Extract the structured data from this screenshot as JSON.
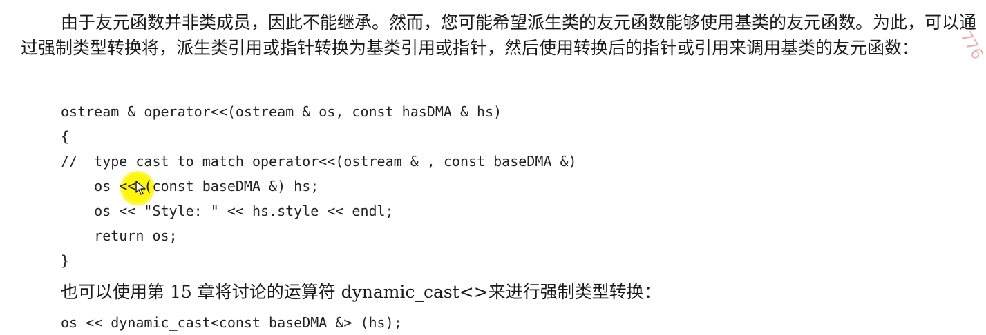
{
  "paragraph1": "由于友元函数并非类成员，因此不能继承。然而，您可能希望派生类的友元函数能够使用基类的友元函数。为此，可以通过强制类型转换将，派生类引用或指针转换为基类引用或指针，然后使用转换后的指针或引用来调用基类的友元函数：",
  "code_lines": [
    "ostream & operator<<(ostream & os, const hasDMA & hs)",
    "{",
    "//  type cast to match operator<<(ostream & , const baseDMA &)",
    "    os << (const baseDMA &) hs;",
    "    os << \"Style: \" << hs.style << endl;",
    "    return os;",
    "}"
  ],
  "paragraph2": "也可以使用第 15 章将讨论的运算符 dynamic_cast<>来进行强制类型转换：",
  "code_line_final": "os << dynamic_cast<const baseDMA &> (hs);",
  "watermark": "776",
  "colors": {
    "highlight": "#fff600",
    "text": "#1a1a1a",
    "watermark": "#f3a9a9"
  }
}
